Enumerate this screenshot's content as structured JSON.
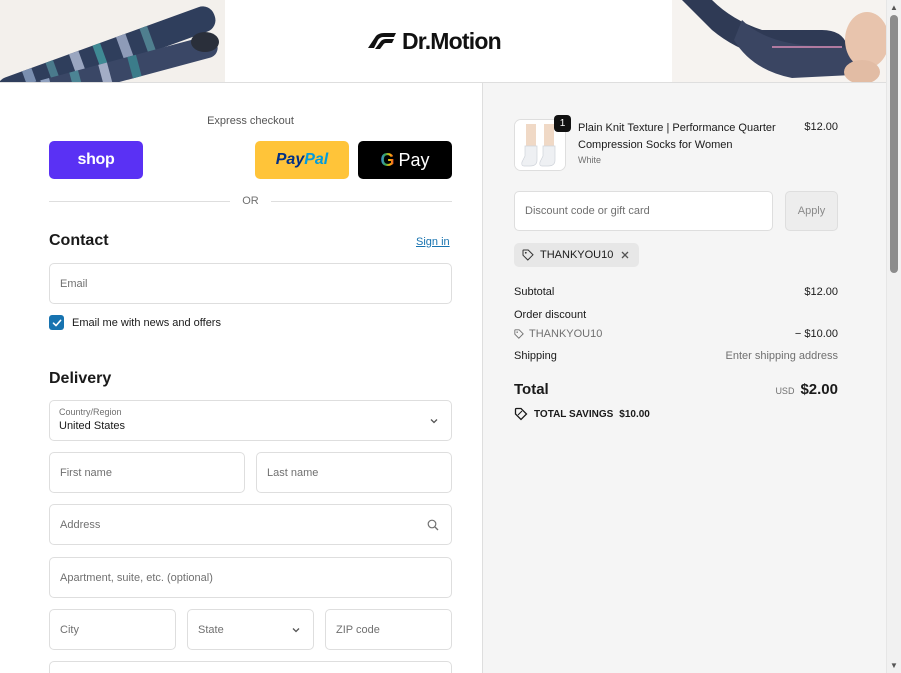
{
  "header": {
    "brand": "Dr.Motion"
  },
  "express": {
    "label": "Express checkout",
    "shop_label": "shop",
    "paypal_a": "Pay",
    "paypal_b": "Pal",
    "gpay_g": "G",
    "gpay_label": "Pay",
    "or_label": "OR"
  },
  "contact": {
    "heading": "Contact",
    "signin": "Sign in",
    "email_placeholder": "Email",
    "newsletter_label": "Email me with news and offers",
    "newsletter_checked": true
  },
  "delivery": {
    "heading": "Delivery",
    "country_label": "Country/Region",
    "country_value": "United States",
    "first_name_placeholder": "First name",
    "last_name_placeholder": "Last name",
    "address_placeholder": "Address",
    "apartment_placeholder": "Apartment, suite, etc. (optional)",
    "city_placeholder": "City",
    "state_placeholder": "State",
    "zip_placeholder": "ZIP code"
  },
  "summary": {
    "product": {
      "quantity": "1",
      "name": "Plain Knit Texture | Performance Quarter Compression Socks for Women",
      "variant": "White",
      "price": "$12.00"
    },
    "discount_placeholder": "Discount code or gift card",
    "apply_label": "Apply",
    "applied_code": "THANKYOU10",
    "subtotal_label": "Subtotal",
    "subtotal_value": "$12.00",
    "order_discount_label": "Order discount",
    "discount_code": "THANKYOU10",
    "discount_value": "− $10.00",
    "shipping_label": "Shipping",
    "shipping_value": "Enter shipping address",
    "total_label": "Total",
    "total_currency": "USD",
    "total_value": "$2.00",
    "savings_label": "TOTAL SAVINGS",
    "savings_value": "$10.00"
  },
  "colors": {
    "shop_pay": "#5a31f4",
    "paypal": "#ffc439",
    "link": "#1773b0",
    "summary_bg": "#f5f5f5"
  }
}
